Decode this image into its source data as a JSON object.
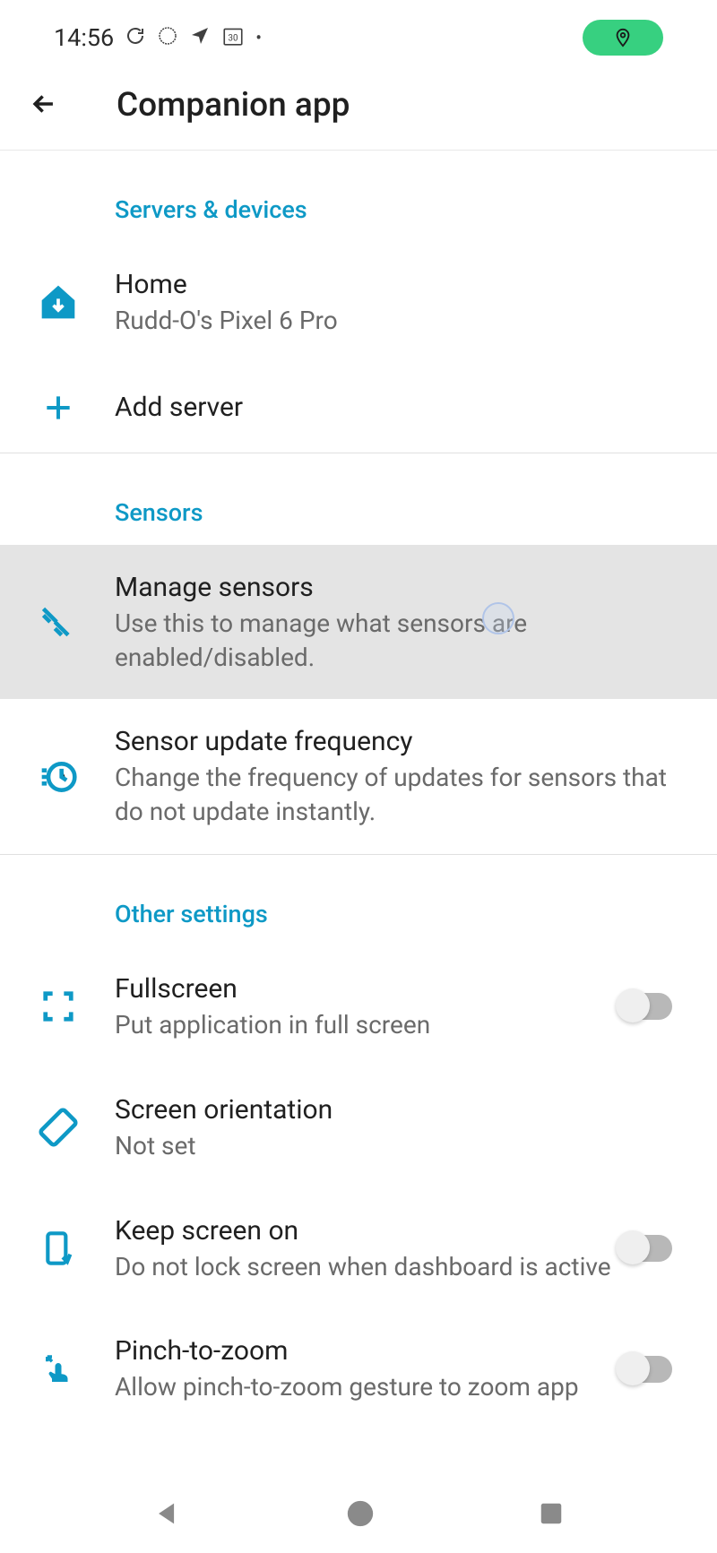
{
  "statusBar": {
    "time": "14:56"
  },
  "appBar": {
    "title": "Companion app"
  },
  "sections": {
    "serversDevices": {
      "header": "Servers & devices",
      "home": {
        "title": "Home",
        "subtitle": "Rudd-O's Pixel 6 Pro"
      },
      "addServer": {
        "title": "Add server"
      }
    },
    "sensors": {
      "header": "Sensors",
      "manageSensors": {
        "title": "Manage sensors",
        "subtitle": "Use this to manage what sensors are enabled/disabled."
      },
      "updateFrequency": {
        "title": "Sensor update frequency",
        "subtitle": "Change the frequency of updates for sensors that do not update instantly."
      }
    },
    "otherSettings": {
      "header": "Other settings",
      "fullscreen": {
        "title": "Fullscreen",
        "subtitle": "Put application in full screen"
      },
      "screenOrientation": {
        "title": "Screen orientation",
        "subtitle": "Not set"
      },
      "keepScreenOn": {
        "title": "Keep screen on",
        "subtitle": "Do not lock screen when dashboard is active"
      },
      "pinchToZoom": {
        "title": "Pinch-to-zoom",
        "subtitle": "Allow pinch-to-zoom gesture to zoom app"
      }
    }
  }
}
